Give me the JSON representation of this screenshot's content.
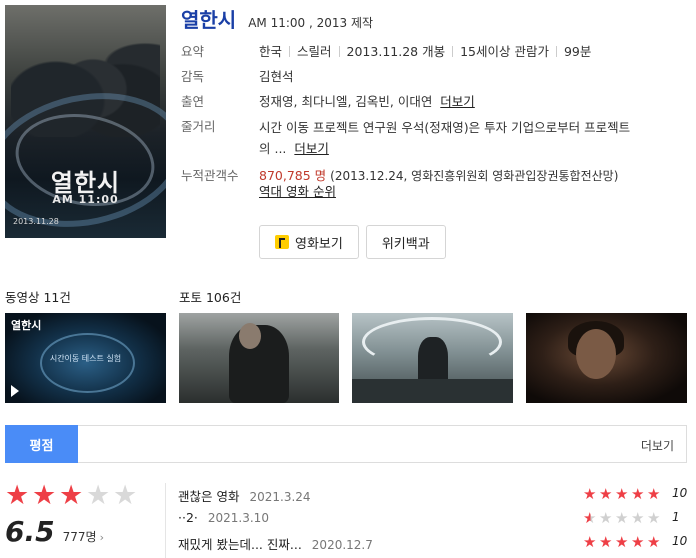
{
  "movie": {
    "title": "열한시",
    "meta": "AM 11:00 , 2013 제작",
    "poster": {
      "title": "열한시",
      "subtitle": "AM 11:00",
      "date": "2013.11.28"
    }
  },
  "info": {
    "summary": {
      "label": "요약",
      "country": "한국",
      "genre": "스릴러",
      "release": "2013.11.28 개봉",
      "rating": "15세이상 관람가",
      "runtime": "99분"
    },
    "director": {
      "label": "감독",
      "value": "김현석"
    },
    "cast": {
      "label": "출연",
      "value": "정재영, 최다니엘, 김옥빈, 이대연",
      "more": "더보기"
    },
    "synopsis": {
      "label": "줄거리",
      "line1": "시간 이동 프로젝트 연구원 우석(정재영)은 투자 기업으로부터 프로젝트",
      "line2": "의 ...",
      "more": "더보기"
    },
    "audience": {
      "label": "누적관객수",
      "count": "870,785 명",
      "note": "(2013.12.24, 영화진흥위원회 영화관입장권통합전산망)",
      "link": "역대 영화 순위"
    }
  },
  "buttons": {
    "watch": "영화보기",
    "wiki": "위키백과"
  },
  "media": {
    "videos_label": "동영상 11건",
    "photos_label": "포토 106건",
    "video_thumb": {
      "logo": "열한시",
      "caption": "시간이동 테스트 실험"
    }
  },
  "rating_tab": {
    "active": "평점",
    "more": "더보기"
  },
  "score": {
    "value": "6.5",
    "count": "777명",
    "stars_filled": 3,
    "stars_total": 5
  },
  "reviews": [
    {
      "text": "괜찮은 영화",
      "date": "2021.3.24",
      "score": "10",
      "stars": 5
    },
    {
      "text": "··2·",
      "date": "2021.3.10",
      "score": "1",
      "stars": 0.5
    },
    {
      "text": "재밌게 봤는데... 진짜...",
      "date": "2020.12.7",
      "score": "10",
      "stars": 5
    }
  ],
  "colors": {
    "title": "#1a3fa6",
    "accent_tab": "#4a8cf7",
    "star": "#ee3f46",
    "audience_count": "#c0392b"
  }
}
